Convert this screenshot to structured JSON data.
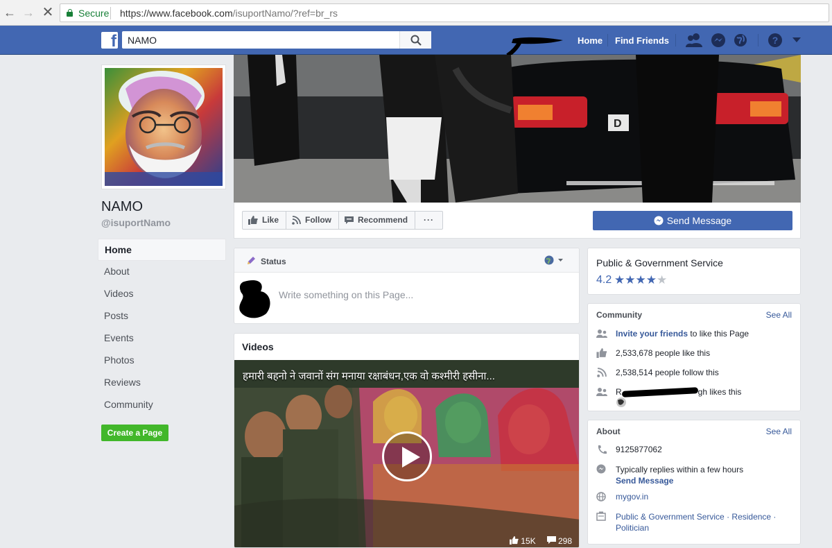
{
  "browser": {
    "secure_label": "Secure",
    "url_host": "https://www.facebook.com",
    "url_path": "/isuportNamo/?ref=br_rs"
  },
  "topbar": {
    "search_value": "NAMO",
    "home_label": "Home",
    "find_friends_label": "Find Friends"
  },
  "page": {
    "name": "NAMO",
    "handle": "@isuportNamo"
  },
  "left_nav": {
    "items": [
      "Home",
      "About",
      "Videos",
      "Posts",
      "Events",
      "Photos",
      "Reviews",
      "Community"
    ],
    "create_page_label": "Create a Page"
  },
  "actions": {
    "like": "Like",
    "follow": "Follow",
    "recommend": "Recommend",
    "more": "···",
    "send_message": "Send Message"
  },
  "composer": {
    "tab_label": "Status",
    "placeholder": "Write something on this Page..."
  },
  "videos": {
    "title": "Videos",
    "video_title": "हमारी बहनो ने जवानों संग मनाया रक्षाबंधन,एक वो कश्मीरी हसीना...",
    "likes": "15K",
    "comments": "298"
  },
  "category": {
    "title": "Public & Government Service",
    "rating": "4.2",
    "stars_filled": 4,
    "stars_total": 5
  },
  "community": {
    "heading": "Community",
    "see_all": "See All",
    "invite_link": "Invite your friends",
    "invite_rest": " to like this Page",
    "likes_text": "2,533,678 people like this",
    "follows_text": "2,538,514 people follow this",
    "friend_prefix": "R",
    "friend_suffix": "gh likes this"
  },
  "about": {
    "heading": "About",
    "see_all": "See All",
    "phone": "9125877062",
    "reply_text": "Typically replies within a few hours",
    "send_message_link": "Send Message",
    "website": "mygov.in",
    "categories": "Public & Government Service · Residence · Politician"
  },
  "colors": {
    "fb_blue": "#4267b2",
    "link": "#365899",
    "green": "#42b72a",
    "background": "#e9ebee"
  }
}
